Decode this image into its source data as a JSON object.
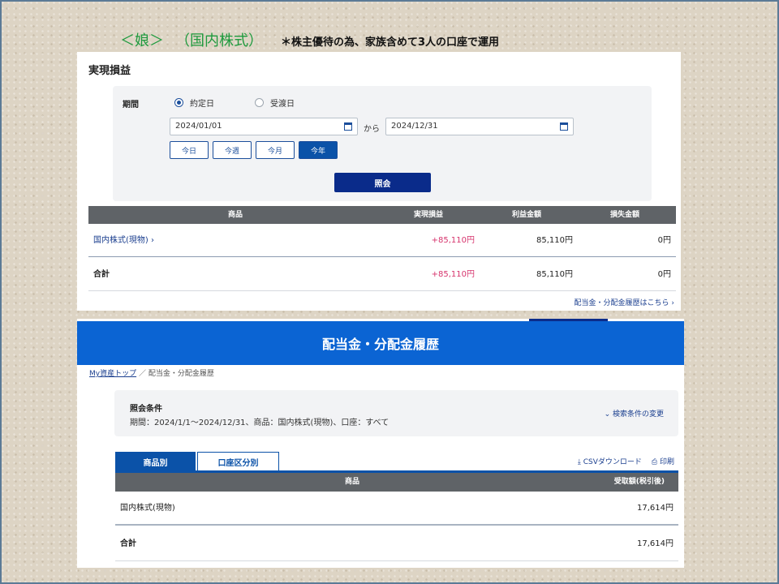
{
  "slide": {
    "who": "＜娘＞",
    "what": "（国内株式）",
    "note": "＊株主優待の為、家族含めて3人の口座で運用"
  },
  "realized": {
    "title": "実現損益",
    "period_label": "期間",
    "radio_contract": "約定日",
    "radio_delivery": "受渡日",
    "date_from": "2024/01/01",
    "kara": "から",
    "date_to": "2024/12/31",
    "quick": [
      "今日",
      "今週",
      "今月",
      "今年"
    ],
    "query_button": "照会",
    "headers": {
      "product": "商品",
      "realized": "実現損益",
      "profit": "利益金額",
      "loss": "損失金額"
    },
    "row": {
      "product": "国内株式(現物)",
      "realized": "+85,110円",
      "profit": "85,110円",
      "loss": "0円"
    },
    "total": {
      "label": "合計",
      "realized": "+85,110円",
      "profit": "85,110円",
      "loss": "0円"
    },
    "footer_link": "配当金・分配金履歴はこちら"
  },
  "dividend": {
    "banner": "配当金・分配金履歴",
    "crumb_link": "My資産トップ",
    "crumb_sep": "／",
    "crumb_current": "配当金・分配金履歴",
    "cond_title": "照会条件",
    "cond_text": "期間：2024/1/1〜2024/12/31、商品：国内株式(現物)、口座：すべて",
    "cond_change": "検索条件の変更",
    "tab_product": "商品別",
    "tab_account": "口座区分別",
    "csv": "CSVダウンロード",
    "print": "印刷",
    "headers": {
      "product": "商品",
      "amount": "受取額(税引後)"
    },
    "row": {
      "product": "国内株式(現物)",
      "amount": "17,614円"
    },
    "total": {
      "label": "合計",
      "amount": "17,614円"
    }
  }
}
